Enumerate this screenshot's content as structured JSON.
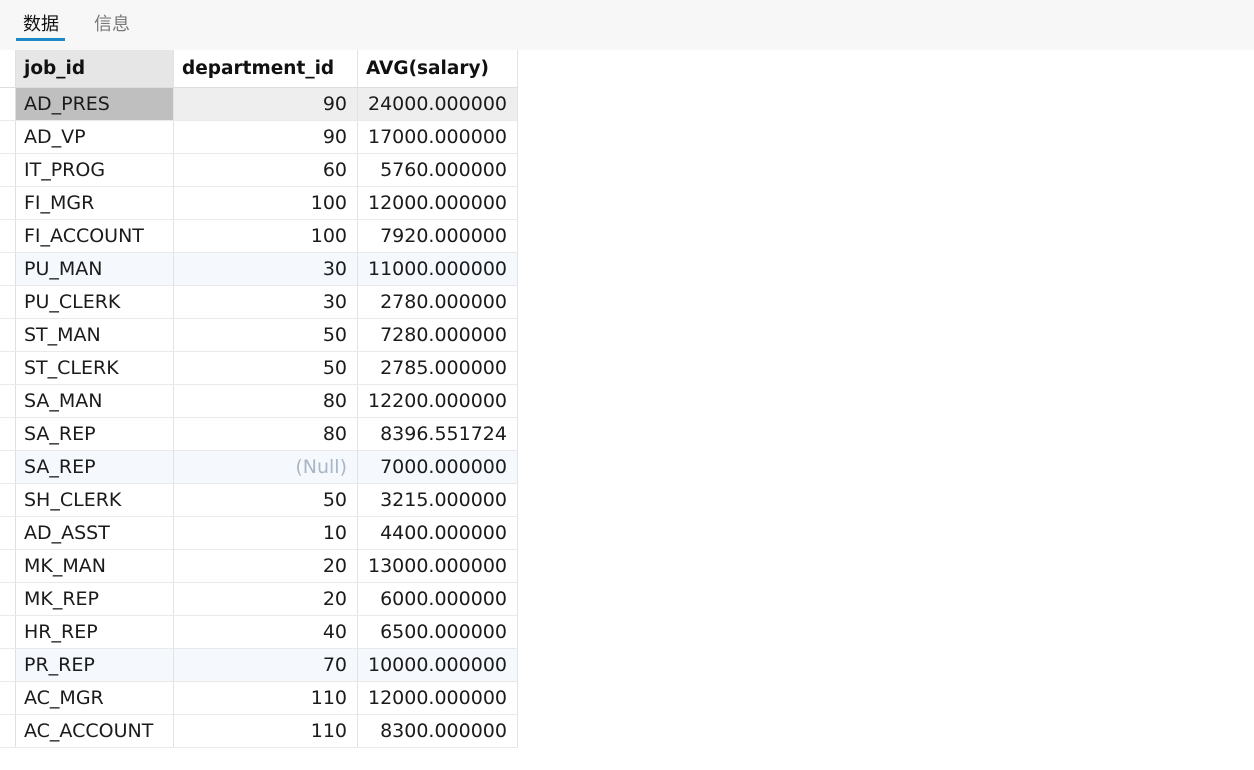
{
  "tabs": [
    {
      "label": "数据"
    },
    {
      "label": "信息"
    }
  ],
  "columns": [
    "job_id",
    "department_id",
    "AVG(salary)"
  ],
  "rows": [
    {
      "job_id": "AD_PRES",
      "department_id": "90",
      "avg_salary": "24000.000000"
    },
    {
      "job_id": "AD_VP",
      "department_id": "90",
      "avg_salary": "17000.000000"
    },
    {
      "job_id": "IT_PROG",
      "department_id": "60",
      "avg_salary": "5760.000000"
    },
    {
      "job_id": "FI_MGR",
      "department_id": "100",
      "avg_salary": "12000.000000"
    },
    {
      "job_id": "FI_ACCOUNT",
      "department_id": "100",
      "avg_salary": "7920.000000"
    },
    {
      "job_id": "PU_MAN",
      "department_id": "30",
      "avg_salary": "11000.000000"
    },
    {
      "job_id": "PU_CLERK",
      "department_id": "30",
      "avg_salary": "2780.000000"
    },
    {
      "job_id": "ST_MAN",
      "department_id": "50",
      "avg_salary": "7280.000000"
    },
    {
      "job_id": "ST_CLERK",
      "department_id": "50",
      "avg_salary": "2785.000000"
    },
    {
      "job_id": "SA_MAN",
      "department_id": "80",
      "avg_salary": "12200.000000"
    },
    {
      "job_id": "SA_REP",
      "department_id": "80",
      "avg_salary": "8396.551724"
    },
    {
      "job_id": "SA_REP",
      "department_id": "(Null)",
      "avg_salary": "7000.000000"
    },
    {
      "job_id": "SH_CLERK",
      "department_id": "50",
      "avg_salary": "3215.000000"
    },
    {
      "job_id": "AD_ASST",
      "department_id": "10",
      "avg_salary": "4400.000000"
    },
    {
      "job_id": "MK_MAN",
      "department_id": "20",
      "avg_salary": "13000.000000"
    },
    {
      "job_id": "MK_REP",
      "department_id": "20",
      "avg_salary": "6000.000000"
    },
    {
      "job_id": "HR_REP",
      "department_id": "40",
      "avg_salary": "6500.000000"
    },
    {
      "job_id": "PR_REP",
      "department_id": "70",
      "avg_salary": "10000.000000"
    },
    {
      "job_id": "AC_MGR",
      "department_id": "110",
      "avg_salary": "12000.000000"
    },
    {
      "job_id": "AC_ACCOUNT",
      "department_id": "110",
      "avg_salary": "8300.000000"
    }
  ],
  "colors": {
    "tab_accent": "#1e88c7",
    "null_text": "#a9b6c6",
    "stripe_a": "#ffffff",
    "stripe_b": "#f5f9fd",
    "selected_cell": "#bfbfbf"
  }
}
